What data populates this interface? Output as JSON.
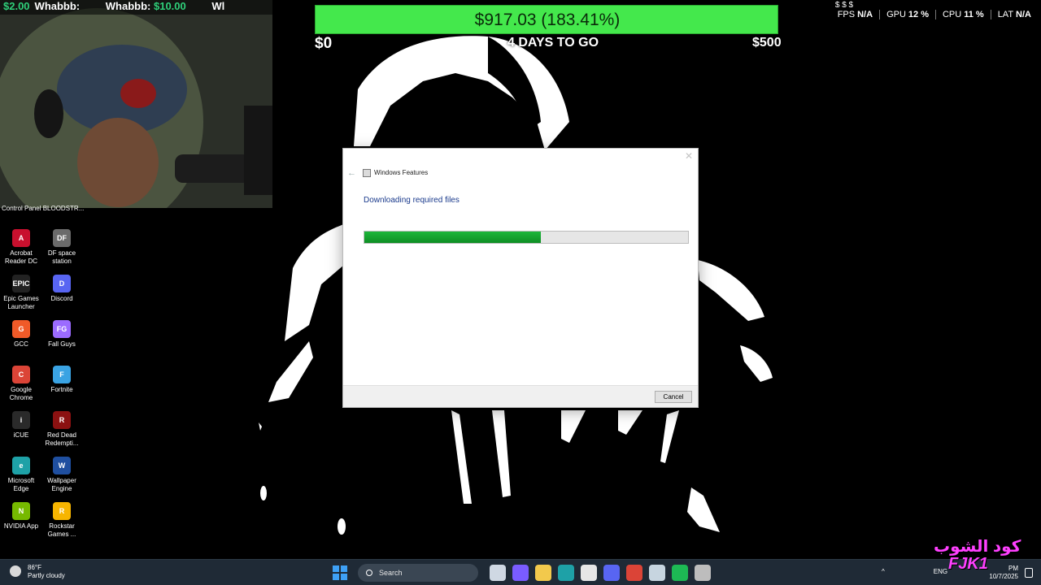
{
  "webcam": {
    "ticker": [
      {
        "amount": "$2.00",
        "user": "Whabbb:"
      },
      {
        "amount": "$10.00",
        "user": "Whabbb:"
      },
      {
        "amount": "$2.00",
        "user": "Wl"
      }
    ]
  },
  "goal": {
    "progress_text": "$917.03 (183.41%)",
    "min": "$0",
    "max": "$500",
    "days": "4 DAYS TO GO",
    "top": "$ $ $",
    "progress_fraction": 1.0
  },
  "perf": {
    "items": [
      {
        "label": "FPS",
        "value": "N/A"
      },
      {
        "label": "GPU",
        "value": "12 %"
      },
      {
        "label": "CPU",
        "value": "11 %"
      },
      {
        "label": "LAT",
        "value": "N/A"
      }
    ]
  },
  "desktop": {
    "top_label": "Control Panel BLOODSTR...",
    "icons": [
      {
        "label": "Acrobat Reader DC",
        "icon": "acrobat-icon",
        "color": "#c8102e",
        "glyph": "A"
      },
      {
        "label": "DF space station",
        "icon": "df-icon",
        "color": "#6a6a6a",
        "glyph": "DF"
      },
      {
        "label": "Epic Games Launcher",
        "icon": "epic-icon",
        "color": "#222222",
        "glyph": "EPIC"
      },
      {
        "label": "Discord",
        "icon": "discord-icon",
        "color": "#5865f2",
        "glyph": "D"
      },
      {
        "label": "GCC",
        "icon": "gcc-icon",
        "color": "#f05a28",
        "glyph": "G"
      },
      {
        "label": "Fall Guys",
        "icon": "fallguys-icon",
        "color": "#9b6bff",
        "glyph": "FG"
      },
      {
        "label": "Google Chrome",
        "icon": "chrome-icon",
        "color": "#db4437",
        "glyph": "C"
      },
      {
        "label": "Fortnite",
        "icon": "fortnite-icon",
        "color": "#3aa3e3",
        "glyph": "F"
      },
      {
        "label": "iCUE",
        "icon": "icue-icon",
        "color": "#2a2a2a",
        "glyph": "i"
      },
      {
        "label": "Red Dead Redempti...",
        "icon": "rdr-icon",
        "color": "#8b1111",
        "glyph": "R"
      },
      {
        "label": "Microsoft Edge",
        "icon": "edge-icon",
        "color": "#1ea1a7",
        "glyph": "e"
      },
      {
        "label": "Wallpaper Engine",
        "icon": "wallpaper-engine-icon",
        "color": "#1f4fa0",
        "glyph": "W"
      },
      {
        "label": "NVIDIA App",
        "icon": "nvidia-icon",
        "color": "#76b900",
        "glyph": "N"
      },
      {
        "label": "Rockstar Games ...",
        "icon": "rockstar-icon",
        "color": "#f7b500",
        "glyph": "R"
      }
    ]
  },
  "dialog": {
    "title": "Windows Features",
    "heading": "Downloading required files",
    "progress_fraction": 0.545,
    "cancel_label": "Cancel",
    "close_glyph": "✕",
    "back_glyph": "←"
  },
  "taskbar": {
    "weather_temp": "86°F",
    "weather_desc": "Partly cloudy",
    "search_placeholder": "Search",
    "tray_lang": "ENG",
    "clock_time": "PM",
    "clock_date": "10/7/2025",
    "apps": [
      {
        "icon": "task-view-icon",
        "color": "#cfd8e3"
      },
      {
        "icon": "copilot-icon",
        "color": "#7a5cff"
      },
      {
        "icon": "file-explorer-icon",
        "color": "#f2c94c"
      },
      {
        "icon": "edge-taskbar-icon",
        "color": "#1ea1a7"
      },
      {
        "icon": "store-icon",
        "color": "#e6e6e6"
      },
      {
        "icon": "discord-taskbar-icon",
        "color": "#5865f2"
      },
      {
        "icon": "chrome-taskbar-icon",
        "color": "#db4437"
      },
      {
        "icon": "steam-icon",
        "color": "#c7d5e0"
      },
      {
        "icon": "spotify-icon",
        "color": "#1db954"
      },
      {
        "icon": "windows-features-taskbar-icon",
        "color": "#bdbdbd"
      }
    ]
  },
  "logo": {
    "arabic": "كود الشوب",
    "latin": "FJK1"
  }
}
